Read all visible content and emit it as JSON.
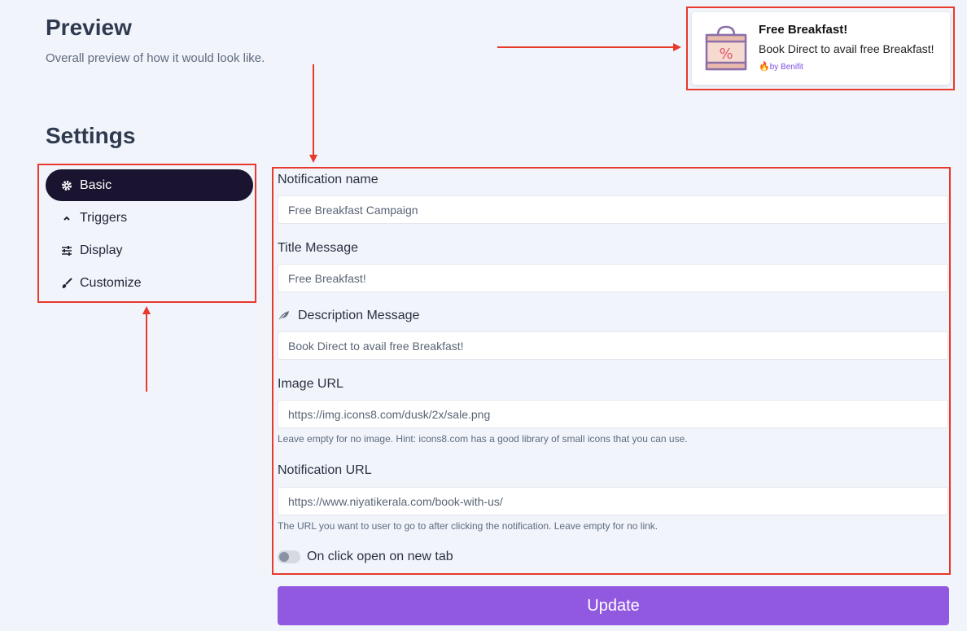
{
  "preview": {
    "title": "Preview",
    "subtitle": "Overall preview of how it would look like."
  },
  "notification": {
    "title": "Free Breakfast!",
    "description": "Book Direct to avail free Breakfast!",
    "brand_fire": "🔥",
    "brand": "by Benifit",
    "image_icon": "sale-bag-percent-icon"
  },
  "settings": {
    "title": "Settings",
    "nav": [
      {
        "label": "Basic",
        "icon": "gear-icon",
        "active": true
      },
      {
        "label": "Triggers",
        "icon": "chevron-up-icon",
        "active": false
      },
      {
        "label": "Display",
        "icon": "sliders-icon",
        "active": false
      },
      {
        "label": "Customize",
        "icon": "brush-icon",
        "active": false
      }
    ]
  },
  "form": {
    "notification_name": {
      "label": "Notification name",
      "value": "Free Breakfast Campaign"
    },
    "title_message": {
      "label": "Title Message",
      "value": "Free Breakfast!"
    },
    "description_message": {
      "label": "Description Message",
      "value": "Book Direct to avail free Breakfast!"
    },
    "image_url": {
      "label": "Image URL",
      "value": "https://img.icons8.com/dusk/2x/sale.png",
      "help": "Leave empty for no image. Hint: icons8.com has a good library of small icons that you can use."
    },
    "notification_url": {
      "label": "Notification URL",
      "value": "https://www.niyatikerala.com/book-with-us/",
      "help": "The URL you want to user to go to after clicking the notification. Leave empty for no link."
    },
    "new_tab_toggle": {
      "label": "On click open on new tab",
      "checked": false
    },
    "update_label": "Update"
  },
  "colors": {
    "accent": "#9159e0",
    "annotation": "#e8392b",
    "nav_active": "#1a1430",
    "background": "#f1f4fb"
  }
}
